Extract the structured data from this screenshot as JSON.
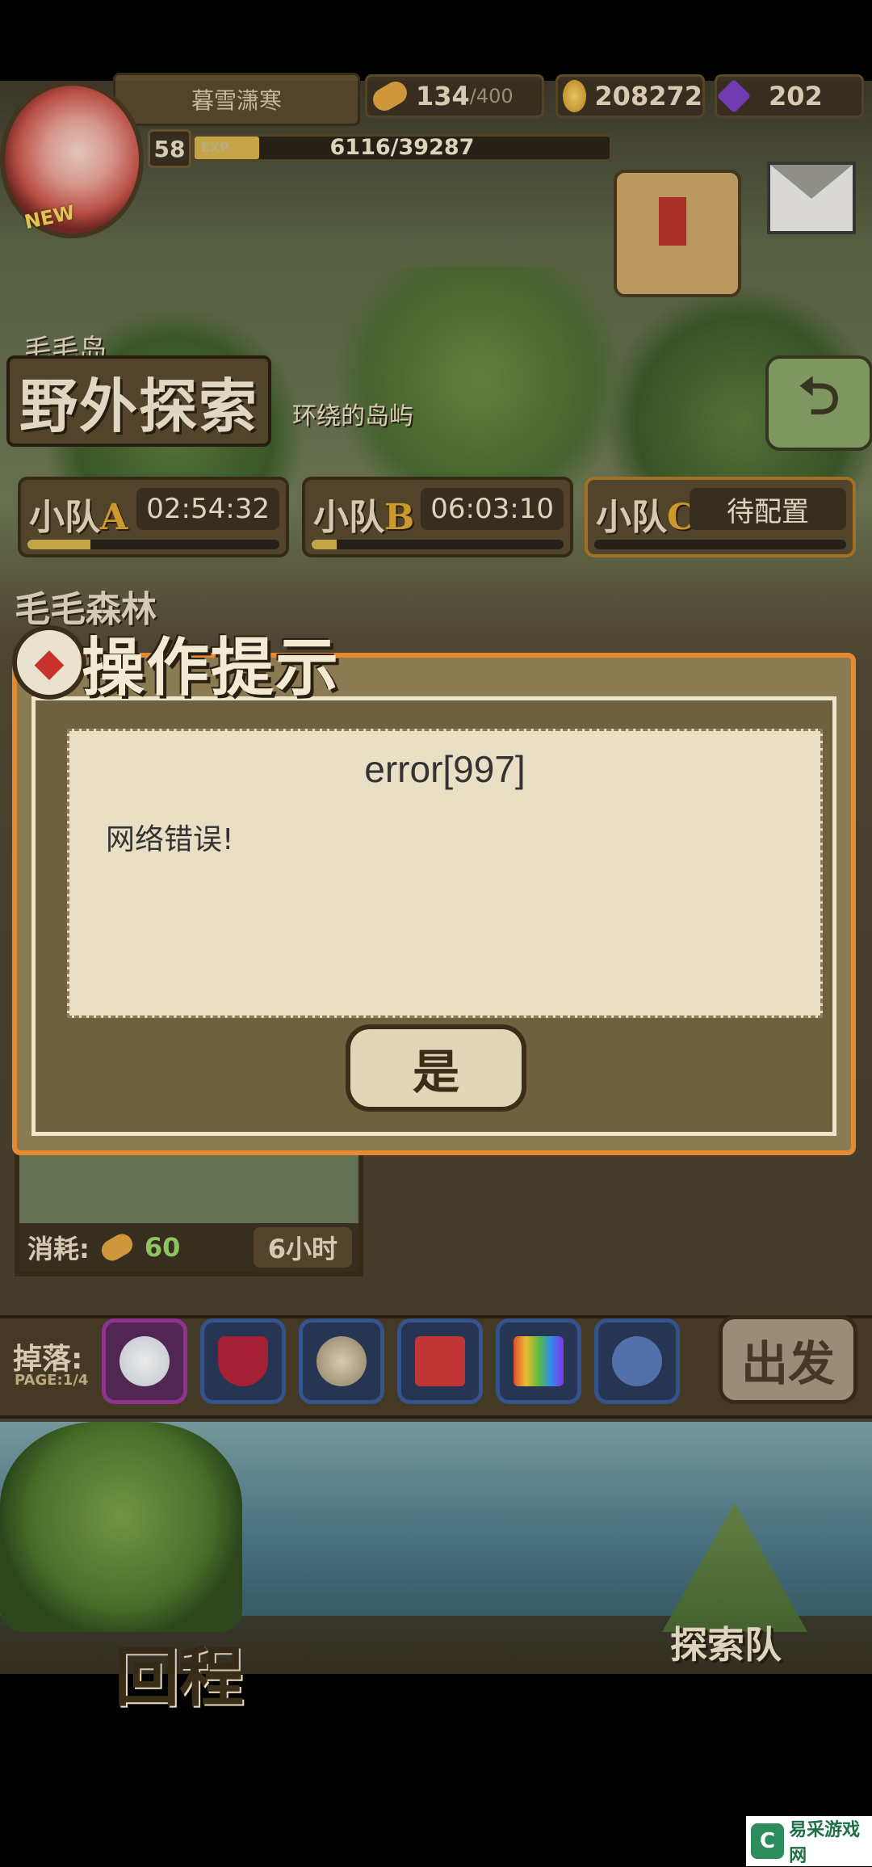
{
  "hud": {
    "player_name": "暮雪潇寒",
    "level": "58",
    "exp_label": "EXP",
    "exp_value": "6116/39287",
    "exp_fraction": 0.156,
    "bread_value": "134",
    "bread_max": "/400",
    "gold_value": "208272",
    "gem_value": "202",
    "new_badge": "NEW"
  },
  "region": {
    "subtitle": "毛毛岛",
    "title": "野外探索",
    "description": "环绕的岛屿"
  },
  "teams": [
    {
      "name": "小队",
      "letter": "A",
      "time": "02:54:32",
      "progress": 0.25
    },
    {
      "name": "小队",
      "letter": "B",
      "time": "06:03:10",
      "progress": 0.1
    },
    {
      "name": "小队",
      "letter": "C",
      "time": "待配置",
      "progress": 0
    }
  ],
  "location_label": "毛毛森林",
  "dialog": {
    "header": "操作提示",
    "title": "error[997]",
    "message": "网络错误!",
    "confirm_label": "是"
  },
  "card": {
    "cost_label": "消耗:",
    "cost_value": "60",
    "duration": "6小时"
  },
  "drops": {
    "label": "掉落:",
    "page": "PAGE:1/4",
    "items": [
      "white-fluff-icon",
      "red-goblet-icon",
      "shells-icon",
      "red-coral-icon",
      "rainbow-cloth-icon",
      "blue-creature-icon"
    ]
  },
  "go_label": "出发",
  "return_label": "回程",
  "explore_team_label": "探索队",
  "watermark": {
    "text": "易采游戏网",
    "logo": "C"
  },
  "colors": {
    "accent_orange": "#e58a2e",
    "brown": "#5a4a2e",
    "gold": "#d4b24c"
  }
}
